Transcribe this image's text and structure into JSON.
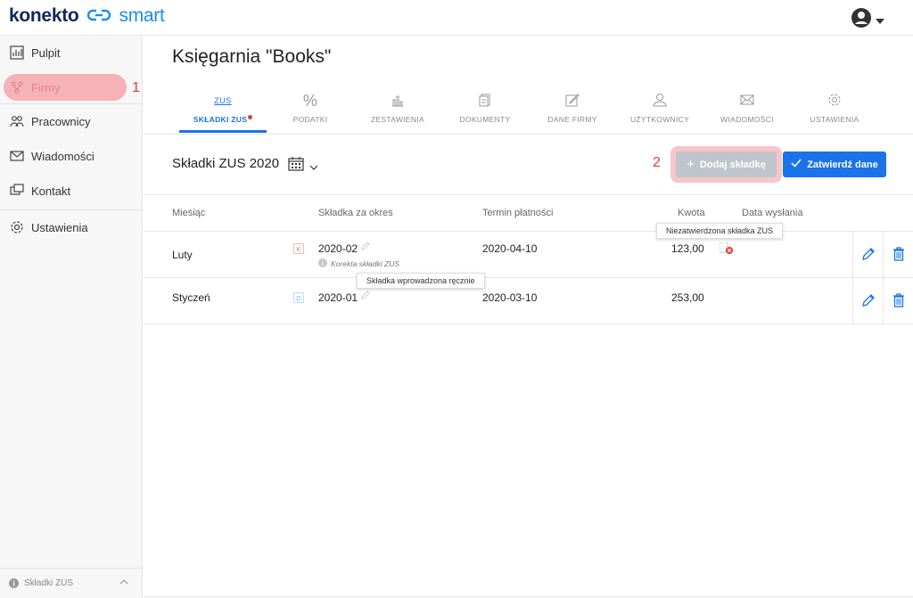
{
  "brand": {
    "part1": "konekto",
    "part2": "smart"
  },
  "colors": {
    "accent": "#1a73e8",
    "brand_dark": "#10275e",
    "highlight": "#f5b3b7",
    "marker": "#e53935"
  },
  "sidebar": {
    "items": [
      {
        "label": "Pulpit",
        "icon": "dashboard-icon"
      },
      {
        "label": "Firmy",
        "icon": "companies-icon"
      },
      {
        "label": "Pracownicy",
        "icon": "employees-icon"
      },
      {
        "label": "Wiadomości",
        "icon": "mail-icon"
      },
      {
        "label": "Kontakt",
        "icon": "contact-icon"
      },
      {
        "label": "Ustawienia",
        "icon": "gear-icon"
      }
    ],
    "footer": "Składki ZUS"
  },
  "markers": {
    "one": "1",
    "two": "2"
  },
  "page_title": "Księgarnia \"Books\"",
  "tabs": [
    {
      "icon_text": "ZUS",
      "label": "SKŁADKI ZUS"
    },
    {
      "icon_text": "%",
      "label": "PODATKI"
    },
    {
      "label": "ZESTAWIENIA"
    },
    {
      "label": "DOKUMENTY"
    },
    {
      "label": "DANE FIRMY"
    },
    {
      "label": "UŻYTKOWNICY"
    },
    {
      "label": "WIADOMOŚCI"
    },
    {
      "label": "USTAWIENIA"
    }
  ],
  "section": {
    "title": "Składki ZUS 2020"
  },
  "buttons": {
    "add": "Dodaj składkę",
    "confirm": "Zatwierdź dane"
  },
  "table": {
    "headers": [
      "Miesiąc",
      "Składka za okres",
      "Termin płatności",
      "Kwota",
      "Data wysłania"
    ],
    "rows": [
      {
        "month": "Luty",
        "badge": "K",
        "period": "2020-02",
        "note": "Korekta składki ZUS",
        "due": "2020-04-10",
        "amount": "123,00"
      },
      {
        "month": "Styczeń",
        "badge": "D",
        "period": "2020-01",
        "due": "2020-03-10",
        "amount": "253,00"
      }
    ]
  },
  "tooltips": {
    "unconfirmed": "Niezatwierdzona składka ZUS",
    "manual": "Składka wprowadzona ręcznie"
  }
}
